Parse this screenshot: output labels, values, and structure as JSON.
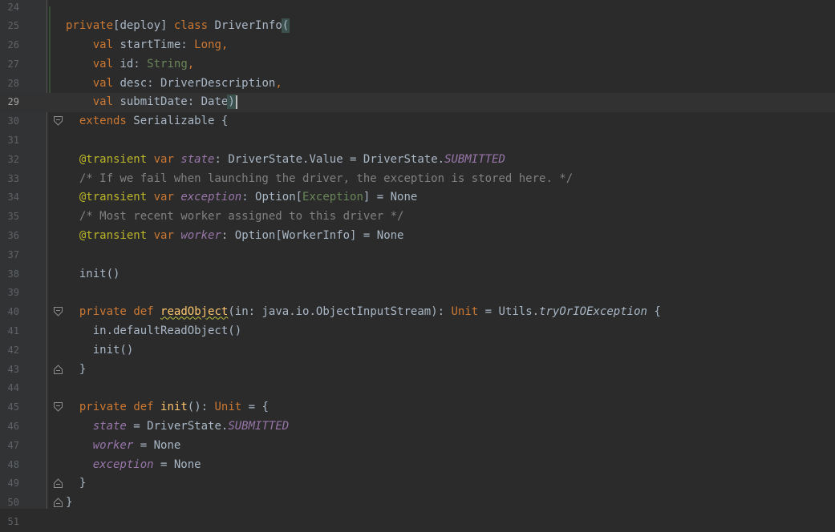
{
  "editor": {
    "current_line": 29,
    "lines": [
      {
        "n": "24",
        "fold": "",
        "tokens": []
      },
      {
        "n": "25",
        "fold": "",
        "tokens": [
          [
            "kw",
            "private"
          ],
          [
            "plain",
            "[deploy] "
          ],
          [
            "kw",
            "class"
          ],
          [
            "plain",
            " DriverInfo"
          ],
          [
            "bparen",
            "("
          ]
        ]
      },
      {
        "n": "26",
        "fold": "",
        "tokens": [
          [
            "plain",
            "    "
          ],
          [
            "kw",
            "val"
          ],
          [
            "plain",
            " startTime: "
          ],
          [
            "kw",
            "Long"
          ],
          [
            "kw",
            ","
          ]
        ]
      },
      {
        "n": "27",
        "fold": "",
        "tokens": [
          [
            "plain",
            "    "
          ],
          [
            "kw",
            "val"
          ],
          [
            "plain",
            " id: "
          ],
          [
            "typ",
            "String"
          ],
          [
            "kw",
            ","
          ]
        ]
      },
      {
        "n": "28",
        "fold": "",
        "tokens": [
          [
            "plain",
            "    "
          ],
          [
            "kw",
            "val"
          ],
          [
            "plain",
            " desc: DriverDescription"
          ],
          [
            "kw",
            ","
          ]
        ]
      },
      {
        "n": "29",
        "fold": "",
        "tokens": [
          [
            "plain",
            "    "
          ],
          [
            "kw",
            "val"
          ],
          [
            "plain",
            " submitDate: Date"
          ],
          [
            "bparen",
            ")"
          ],
          [
            "caret",
            ""
          ]
        ]
      },
      {
        "n": "30",
        "fold": "open",
        "tokens": [
          [
            "plain",
            "  "
          ],
          [
            "kw",
            "extends"
          ],
          [
            "plain",
            " Serializable {"
          ]
        ]
      },
      {
        "n": "31",
        "fold": "",
        "tokens": []
      },
      {
        "n": "32",
        "fold": "",
        "tokens": [
          [
            "plain",
            "  "
          ],
          [
            "ann",
            "@transient"
          ],
          [
            "plain",
            " "
          ],
          [
            "kw",
            "var"
          ],
          [
            "plain",
            " "
          ],
          [
            "fld",
            "state"
          ],
          [
            "plain",
            ": DriverState.Value = DriverState."
          ],
          [
            "const",
            "SUBMITTED"
          ]
        ]
      },
      {
        "n": "33",
        "fold": "",
        "tokens": [
          [
            "plain",
            "  "
          ],
          [
            "cm",
            "/* If we fail when launching the driver, the exception is stored here. */"
          ]
        ]
      },
      {
        "n": "34",
        "fold": "",
        "tokens": [
          [
            "plain",
            "  "
          ],
          [
            "ann",
            "@transient"
          ],
          [
            "plain",
            " "
          ],
          [
            "kw",
            "var"
          ],
          [
            "plain",
            " "
          ],
          [
            "fld",
            "exception"
          ],
          [
            "plain",
            ": Option["
          ],
          [
            "typ",
            "Exception"
          ],
          [
            "plain",
            "] = None"
          ]
        ]
      },
      {
        "n": "35",
        "fold": "",
        "tokens": [
          [
            "plain",
            "  "
          ],
          [
            "cm",
            "/* Most recent worker assigned to this driver */"
          ]
        ]
      },
      {
        "n": "36",
        "fold": "",
        "tokens": [
          [
            "plain",
            "  "
          ],
          [
            "ann",
            "@transient"
          ],
          [
            "plain",
            " "
          ],
          [
            "kw",
            "var"
          ],
          [
            "plain",
            " "
          ],
          [
            "fld",
            "worker"
          ],
          [
            "plain",
            ": Option[WorkerInfo] = None"
          ]
        ]
      },
      {
        "n": "37",
        "fold": "",
        "tokens": []
      },
      {
        "n": "38",
        "fold": "",
        "tokens": [
          [
            "plain",
            "  init()"
          ]
        ]
      },
      {
        "n": "39",
        "fold": "",
        "tokens": []
      },
      {
        "n": "40",
        "fold": "open",
        "tokens": [
          [
            "plain",
            "  "
          ],
          [
            "kw",
            "private"
          ],
          [
            "plain",
            " "
          ],
          [
            "kw",
            "def"
          ],
          [
            "plain",
            " "
          ],
          [
            "fnu",
            "readObject"
          ],
          [
            "plain",
            "(in: java.io.ObjectInputStream): "
          ],
          [
            "kw",
            "Unit"
          ],
          [
            "plain",
            " = Utils."
          ],
          [
            "ex",
            "tryOrIOException"
          ],
          [
            "plain",
            " {"
          ]
        ]
      },
      {
        "n": "41",
        "fold": "",
        "tokens": [
          [
            "plain",
            "    in.defaultReadObject()"
          ]
        ]
      },
      {
        "n": "42",
        "fold": "",
        "tokens": [
          [
            "plain",
            "    init()"
          ]
        ]
      },
      {
        "n": "43",
        "fold": "close",
        "tokens": [
          [
            "plain",
            "  }"
          ]
        ]
      },
      {
        "n": "44",
        "fold": "",
        "tokens": []
      },
      {
        "n": "45",
        "fold": "open",
        "tokens": [
          [
            "plain",
            "  "
          ],
          [
            "kw",
            "private"
          ],
          [
            "plain",
            " "
          ],
          [
            "kw",
            "def"
          ],
          [
            "plain",
            " "
          ],
          [
            "fn",
            "init"
          ],
          [
            "plain",
            "(): "
          ],
          [
            "kw",
            "Unit"
          ],
          [
            "plain",
            " = {"
          ]
        ]
      },
      {
        "n": "46",
        "fold": "",
        "tokens": [
          [
            "plain",
            "    "
          ],
          [
            "fld",
            "state"
          ],
          [
            "plain",
            " = DriverState."
          ],
          [
            "const",
            "SUBMITTED"
          ]
        ]
      },
      {
        "n": "47",
        "fold": "",
        "tokens": [
          [
            "plain",
            "    "
          ],
          [
            "fld",
            "worker"
          ],
          [
            "plain",
            " = None"
          ]
        ]
      },
      {
        "n": "48",
        "fold": "",
        "tokens": [
          [
            "plain",
            "    "
          ],
          [
            "fld",
            "exception"
          ],
          [
            "plain",
            " = None"
          ]
        ]
      },
      {
        "n": "49",
        "fold": "close",
        "tokens": [
          [
            "plain",
            "  }"
          ]
        ]
      },
      {
        "n": "50",
        "fold": "close",
        "tokens": [
          [
            "plain",
            "}"
          ]
        ]
      },
      {
        "n": "51",
        "fold": "",
        "tokens": []
      }
    ]
  }
}
